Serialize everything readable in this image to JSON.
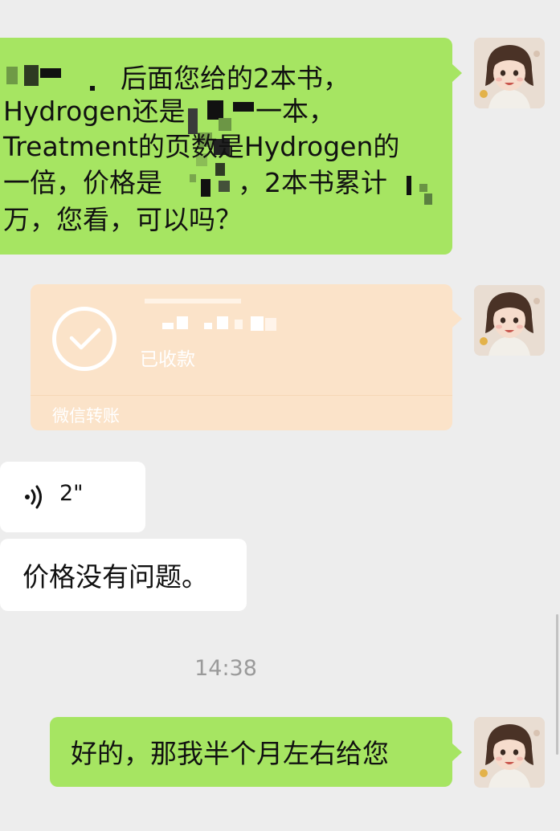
{
  "messages": {
    "m1": {
      "lines": [
        "后面您给的2本书，",
        "Hydrogen还是",
        "一本，",
        "Treatment的页数是Hydrogen的",
        "一倍，价格是",
        "，2本书累计",
        "万，您看，可以吗？"
      ]
    },
    "transfer": {
      "status": "已收款",
      "footer": "微信转账"
    },
    "voice": {
      "duration": "2\""
    },
    "text2": "价格没有问题。",
    "timestamp": "14:38",
    "m3": "好的，那我半个月左右给您"
  },
  "colors": {
    "background": "#ededed",
    "sent_bubble": "#a6e562",
    "transfer_bubble": "#fbe3c9",
    "received_bubble": "#ffffff",
    "timestamp_text": "#9a9a9a"
  },
  "icons": {
    "avatar": "cartoon-girl-avatar",
    "transfer": "check-circle-icon",
    "voice": "voice-wave-icon"
  }
}
